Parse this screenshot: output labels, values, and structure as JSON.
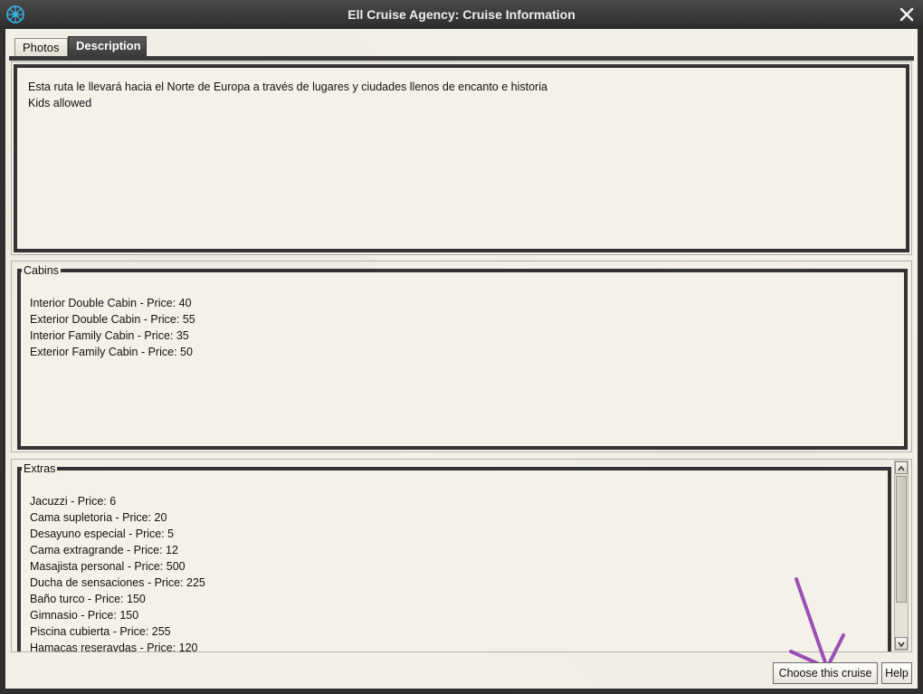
{
  "window": {
    "title": "Ell Cruise Agency: Cruise Information",
    "app_icon": "compass-icon",
    "close_icon": "close-icon"
  },
  "tabs": [
    {
      "label": "Photos",
      "active": false
    },
    {
      "label": "Description",
      "active": true
    }
  ],
  "description": {
    "lines": [
      "Esta ruta le llevará hacia el Norte de Europa a través de lugares y ciudades llenos de encanto e historia",
      "Kids allowed"
    ]
  },
  "cabins": {
    "legend": "Cabins",
    "items": [
      "Interior Double Cabin - Price: 40",
      "Exterior Double Cabin - Price: 55",
      "Interior Family Cabin - Price: 35",
      "Exterior Family Cabin - Price: 50"
    ]
  },
  "extras": {
    "legend": "Extras",
    "items": [
      "Jacuzzi - Price: 6",
      "Cama supletoria - Price: 20",
      "Desayuno especial - Price: 5",
      "Cama extragrande - Price: 12",
      "Masajista personal - Price: 500",
      "Ducha de sensaciones - Price: 225",
      "Baño turco - Price: 150",
      "Gimnasio - Price: 150",
      "Piscina cubierta - Price: 255",
      "Hamacas reseravdas - Price: 120"
    ]
  },
  "buttons": {
    "choose_label": "Choose this cruise",
    "help_label": "Help"
  },
  "colors": {
    "annotation_arrow": "#9b4fb5",
    "frame": "#333333",
    "background": "#f3f0e8"
  }
}
